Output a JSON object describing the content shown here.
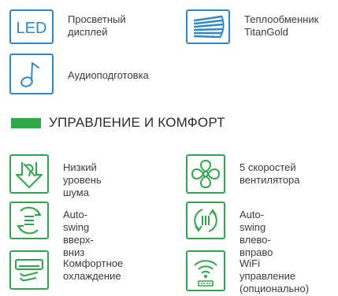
{
  "top_features": [
    {
      "icon": "led-display-icon",
      "text": "LED",
      "label": "Просветный\nдисплей"
    },
    {
      "icon": "heat-exchanger-icon",
      "label": "Теплообменник\nTitanGold"
    },
    {
      "icon": "music-note-icon",
      "label": "Аудиоподготовка"
    }
  ],
  "section": {
    "title": "УПРАВЛЕНИЕ И КОМФОРТ"
  },
  "comfort_features": [
    {
      "icon": "low-noise-icon",
      "label": "Низкий\nуровень шума"
    },
    {
      "icon": "fan-icon",
      "label": "5 скоростей\nвентилятора"
    },
    {
      "icon": "vertical-swing-icon",
      "label": "Auto-swing\nвверх-вниз"
    },
    {
      "icon": "horizontal-swing-icon",
      "label": "Auto-swing\nвлево-вправо"
    },
    {
      "icon": "comfort-cooling-icon",
      "label": "Комфортное\nохлаждение"
    },
    {
      "icon": "wifi-icon",
      "label": "WiFi управление\n(опционально)"
    }
  ],
  "colors": {
    "blue": "#2f89c8",
    "green": "#2ea84a",
    "text": "#3b3b3b"
  }
}
